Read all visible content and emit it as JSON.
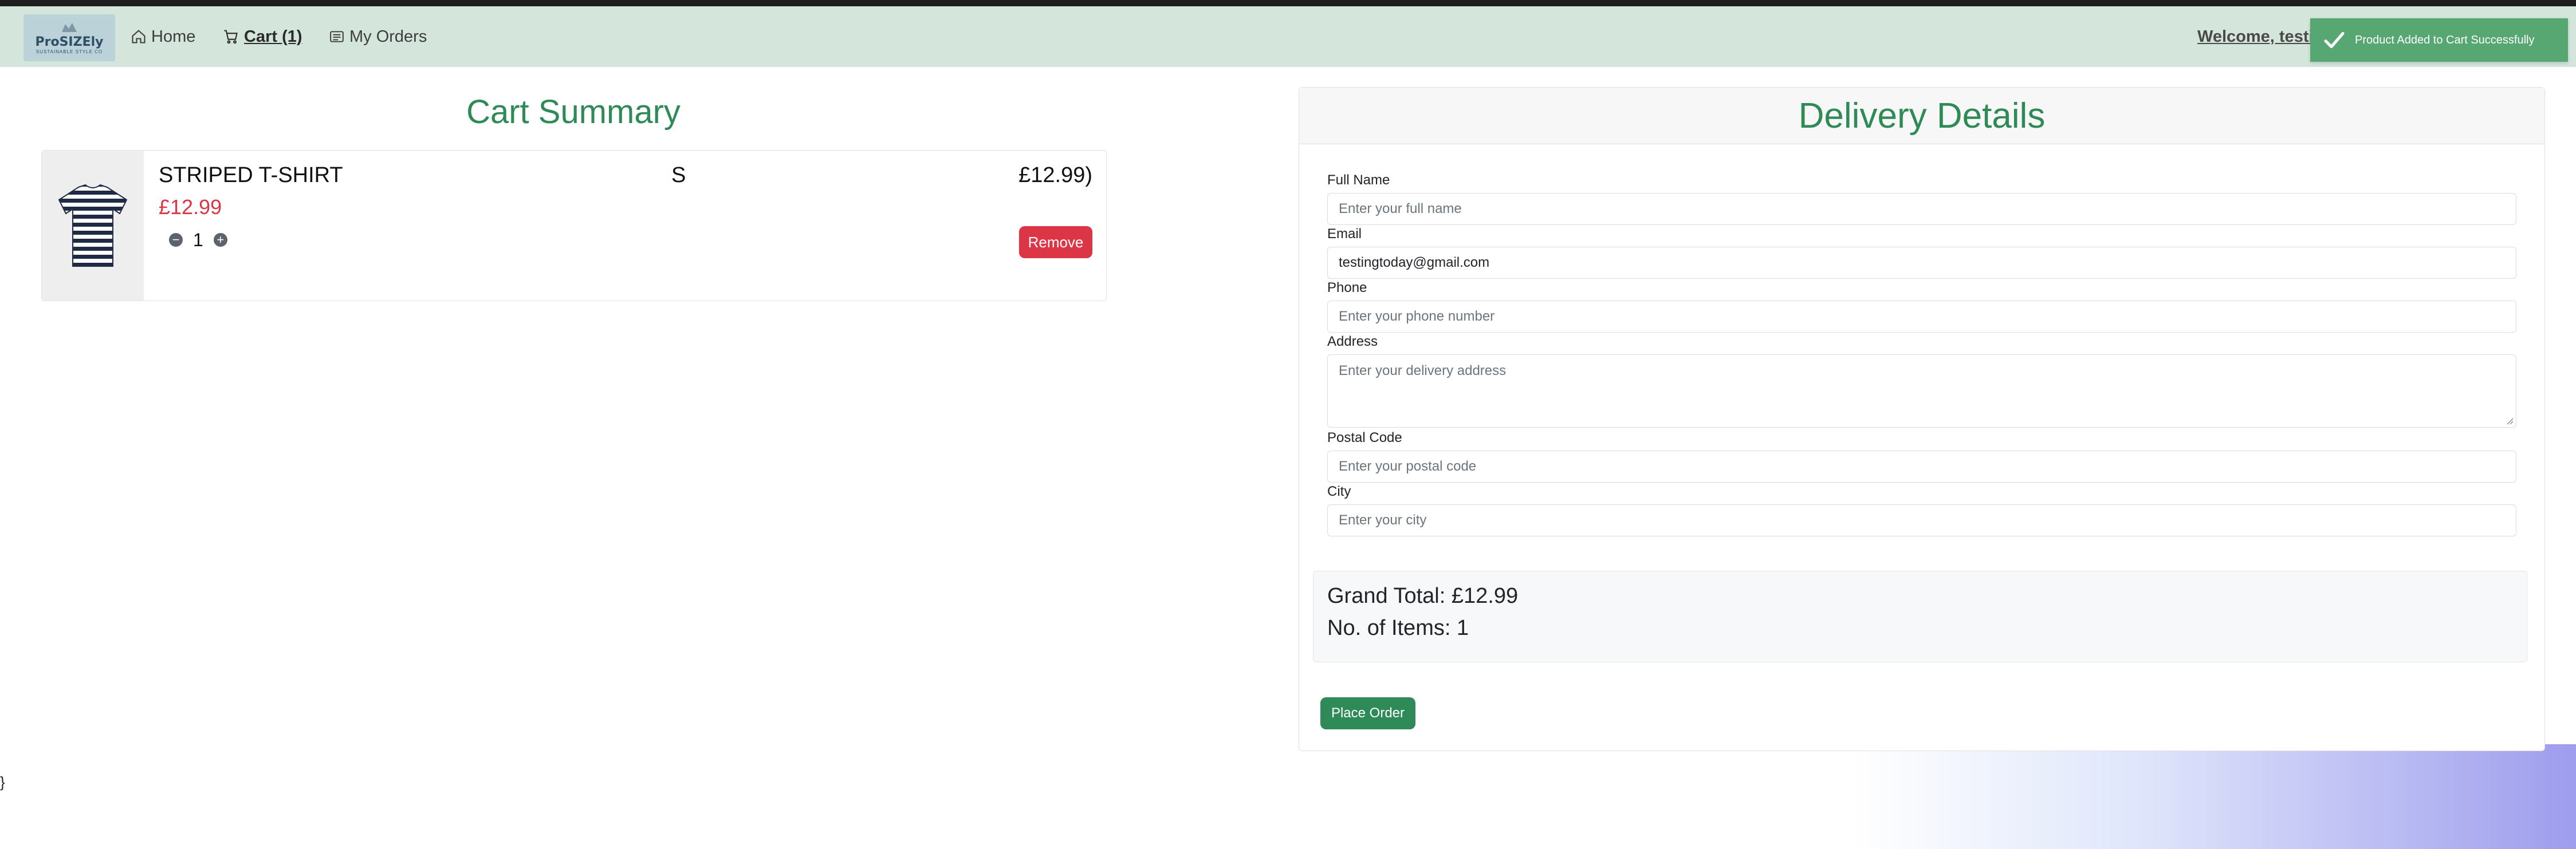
{
  "navbar": {
    "logo_text": "ProSIZEly",
    "logo_tagline": "SUSTAINABLE STYLE CO",
    "links": [
      {
        "label": "Home"
      },
      {
        "label": "Cart (1)"
      },
      {
        "label": "My Orders"
      }
    ],
    "welcome": "Welcome, testi"
  },
  "toast": {
    "message": "Product Added to Cart Successfully"
  },
  "cart": {
    "title": "Cart Summary",
    "item": {
      "name": "STRIPED T-SHIRT",
      "size": "S",
      "line_total": "£12.99)",
      "price": "£12.99",
      "quantity": "1",
      "minus_symbol": "−",
      "plus_symbol": "+",
      "remove_label": "Remove"
    }
  },
  "delivery": {
    "title": "Delivery Details",
    "fields": [
      {
        "label": "Full Name",
        "value": "",
        "placeholder": "Enter your full name"
      },
      {
        "label": "Email",
        "value": "testingtoday@gmail.com",
        "placeholder": ""
      },
      {
        "label": "Phone",
        "value": "",
        "placeholder": "Enter your phone number"
      },
      {
        "label": "Address",
        "value": "",
        "placeholder": "Enter your delivery address"
      },
      {
        "label": "Postal Code",
        "value": "",
        "placeholder": "Enter your postal code"
      },
      {
        "label": "City",
        "value": "",
        "placeholder": "Enter your city"
      }
    ],
    "grand_total": "Grand Total: £12.99",
    "item_count": "No. of Items: 1",
    "place_order_label": "Place Order"
  },
  "stray_text": "}",
  "colors": {
    "navbar_bg": "#d4e5dc",
    "accent_green": "#2e8a57",
    "danger_red": "#dc3545",
    "toast_green": "#57a773"
  },
  "icons": [
    "home-icon",
    "cart-icon",
    "orders-icon",
    "check-icon",
    "minus-circle-icon",
    "plus-circle-icon"
  ]
}
